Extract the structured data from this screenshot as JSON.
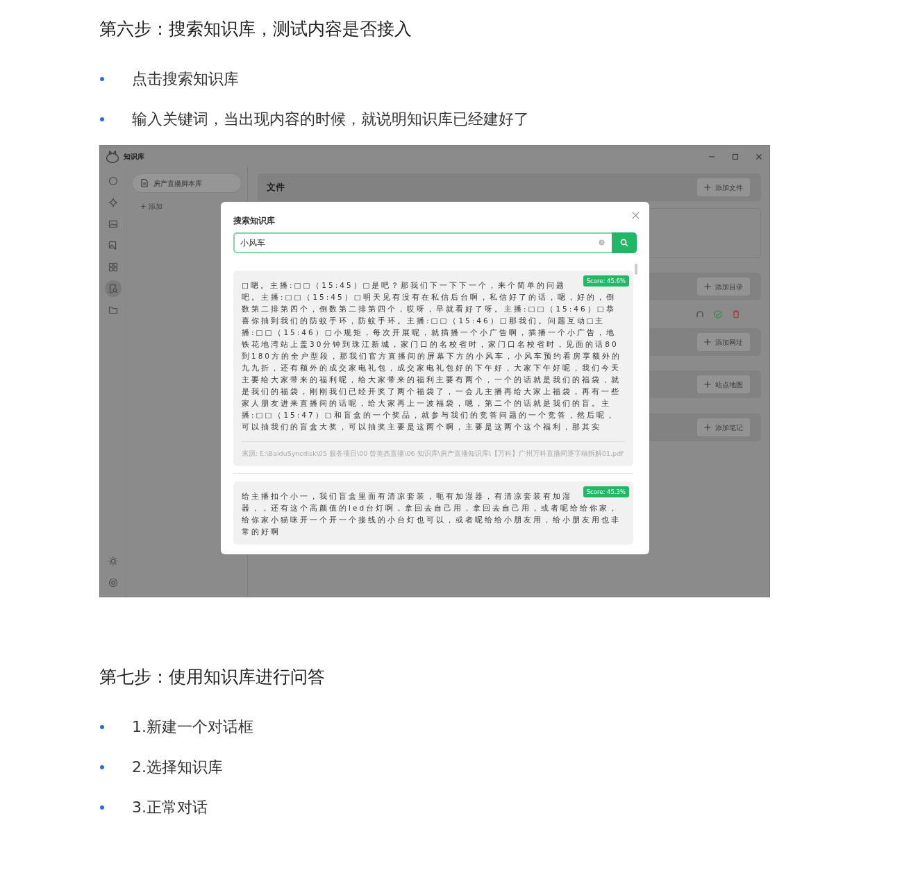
{
  "sections": [
    {
      "heading": "第六步：搜索知识库，测试内容是否接入",
      "bullets": [
        "点击搜索知识库",
        "输入关键词，当出现内容的时候，就说明知识库已经建好了"
      ],
      "screenshot": {
        "window": {
          "title": "知识库"
        },
        "rail_items": [
          {
            "selected": false
          },
          {
            "selected": false
          },
          {
            "selected": false
          },
          {
            "selected": false
          },
          {
            "selected": false
          },
          {
            "selected": true
          },
          {
            "selected": false
          }
        ],
        "libraries": [
          {
            "label": "房产直播脚本库",
            "selected": true
          }
        ],
        "add_library": "+ 添加",
        "files_header": "文件",
        "buttons": [
          "添加文件",
          "添加目录",
          "添加网址",
          "站点地图",
          "添加笔记"
        ],
        "search_dialog": {
          "title": "搜索知识库",
          "query": "小风车",
          "results": [
            {
              "score": "Score: 45.6%",
              "text": "□嗯。主播:□□（15:45）□是吧？那我们下一下下一个，来个简单的问题吧。主播:□□（15:45）□明天见有没有在私信后台啊，私信好了的话，嗯，好的，倒数第二排第四个，倒数第二排第四个，哎呀，早就看好了呀。主播:□□（15:46）□恭喜你抽到我们的防蚊手环，防蚊手环。主播:□□（15:46）□那我们。问题互动□主播:□□（15:46）□小规矩，每次开展呢，就插播一个小广告啊，插播一个小广告，地铁花地湾站上盖30分钟到珠江新城，家门口的名校省时，家门口名校省时，见面的话80到180方的全户型段，那我们官方直播间的屏幕下方的小风车，小风车预约看房享额外的九九折，还有额外的成交家电礼包，成交家电礼包好的下午好，大家下午好呢，我们今天主要给大家带来的福利呢，给大家带来的福利主要有两个，一个的话就是我们的福袋，就是我们的福袋，刚刚我们已经开奖了两个福袋了，一会儿主播再给大家上福袋，再有一些家人朋友进来直播间的话呢，给大家再上一波福袋，嗯，第二个的话就是我们的盲。主播:□□（15:47）□和盲盒的一个奖品，就参与我们的竞答问题的一个竞答，然后呢，可以抽我们的盲盒大奖，可以抽奖主要是这两个啊，主要是这两个这个福利，那其实",
              "source": "来源: E:\\BaiduSyncdisk\\05 服务项目\\00 曾英杰直播\\06 知识库\\房产直播知识库\\【万科】广州万科直播间逐字稿拆解01.pdf"
            },
            {
              "score": "Score: 45.3%",
              "text": "给主播扣个小一，我们盲盒里面有清凉套装，呃有加湿器，有清凉套装有加湿器，，还有这个高颜值的led台灯啊，拿回去自己用，拿回去自己用，或者呢给给你家，给你家小猫咪开一个开一个接线的小台灯也可以，或者呢给给小朋友用，给小朋友用也非常的好啊"
            }
          ]
        }
      }
    },
    {
      "heading": "第七步：使用知识库进行问答",
      "bullets": [
        "1.新建一个对话框",
        "2.选择知识库",
        "3.正常对话"
      ]
    }
  ]
}
